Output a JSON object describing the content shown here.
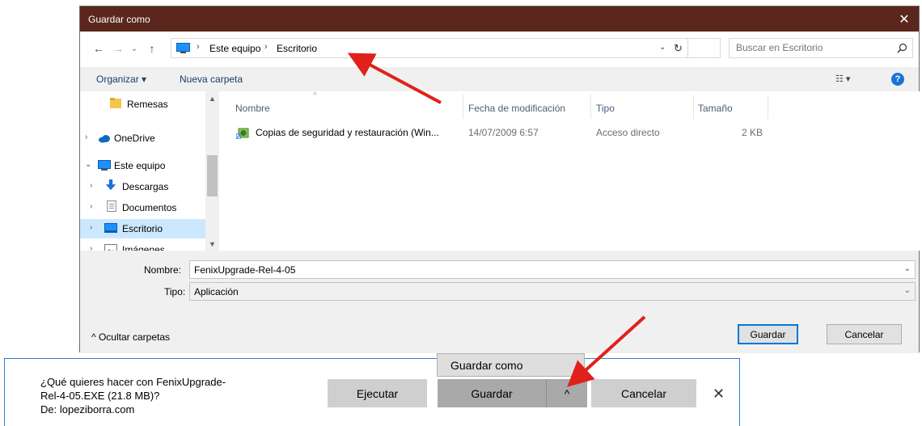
{
  "dialog": {
    "title": "Guardar como",
    "close_glyph": "✕",
    "nav_glyphs": {
      "back": "←",
      "forward": "→",
      "recent": "⌄",
      "up": "↑"
    },
    "breadcrumb": [
      "Este equipo",
      "Escritorio"
    ],
    "crumb_separator": "›",
    "address_dropdown_glyph": "⌄",
    "refresh_glyph": "↻",
    "search_placeholder": "Buscar en Escritorio",
    "toolbar": {
      "organize": "Organizar ▾",
      "new_folder": "Nueva carpeta",
      "view_glyph": "☷ ▾",
      "help": "?"
    },
    "sidebar": [
      {
        "label": "Remesas",
        "icon": "folder-icon",
        "expand": ""
      },
      {
        "label": "OneDrive",
        "icon": "cloud-icon",
        "expand": "›"
      },
      {
        "label": "Este equipo",
        "icon": "pc-icon",
        "expand": "⌄"
      },
      {
        "label": "Descargas",
        "icon": "download-icon",
        "expand": "›"
      },
      {
        "label": "Documentos",
        "icon": "document-icon",
        "expand": "›"
      },
      {
        "label": "Escritorio",
        "icon": "desktop-icon",
        "expand": "›"
      },
      {
        "label": "Imágenes",
        "icon": "pictures-icon",
        "expand": "›"
      }
    ],
    "sort_glyph": "^",
    "columns": {
      "name": "Nombre",
      "date": "Fecha de modificación",
      "type": "Tipo",
      "size": "Tamaño"
    },
    "files": [
      {
        "name": "Copias de seguridad y restauración (Win...",
        "date": "14/07/2009 6:57",
        "type": "Acceso directo",
        "size": "2 KB",
        "icon": "shortcut-icon"
      }
    ],
    "filename_label": "Nombre:",
    "filename_value": "FenixUpgrade-Rel-4-05",
    "filetype_label": "Tipo:",
    "filetype_value": "Aplicación",
    "field_dropdown_glyph": "⌄",
    "hide_folders": "^ Ocultar carpetas",
    "save_button": "Guardar",
    "cancel_button": "Cancelar"
  },
  "download_bar": {
    "prompt_line1": "¿Qué quieres hacer con FenixUpgrade-",
    "prompt_line2": "Rel-4-05.EXE (21.8 MB)?",
    "prompt_line3": "De: lopeziborra.com",
    "run_button": "Ejecutar",
    "save_button": "Guardar",
    "save_dropdown_glyph": "^",
    "cancel_button": "Cancelar",
    "close_glyph": "✕",
    "menu_item": "Guardar como"
  },
  "colors": {
    "titlebar": "#5b271d",
    "selection": "#cce8ff",
    "accent": "#0078d7",
    "annotation_arrow": "#e0211b"
  }
}
